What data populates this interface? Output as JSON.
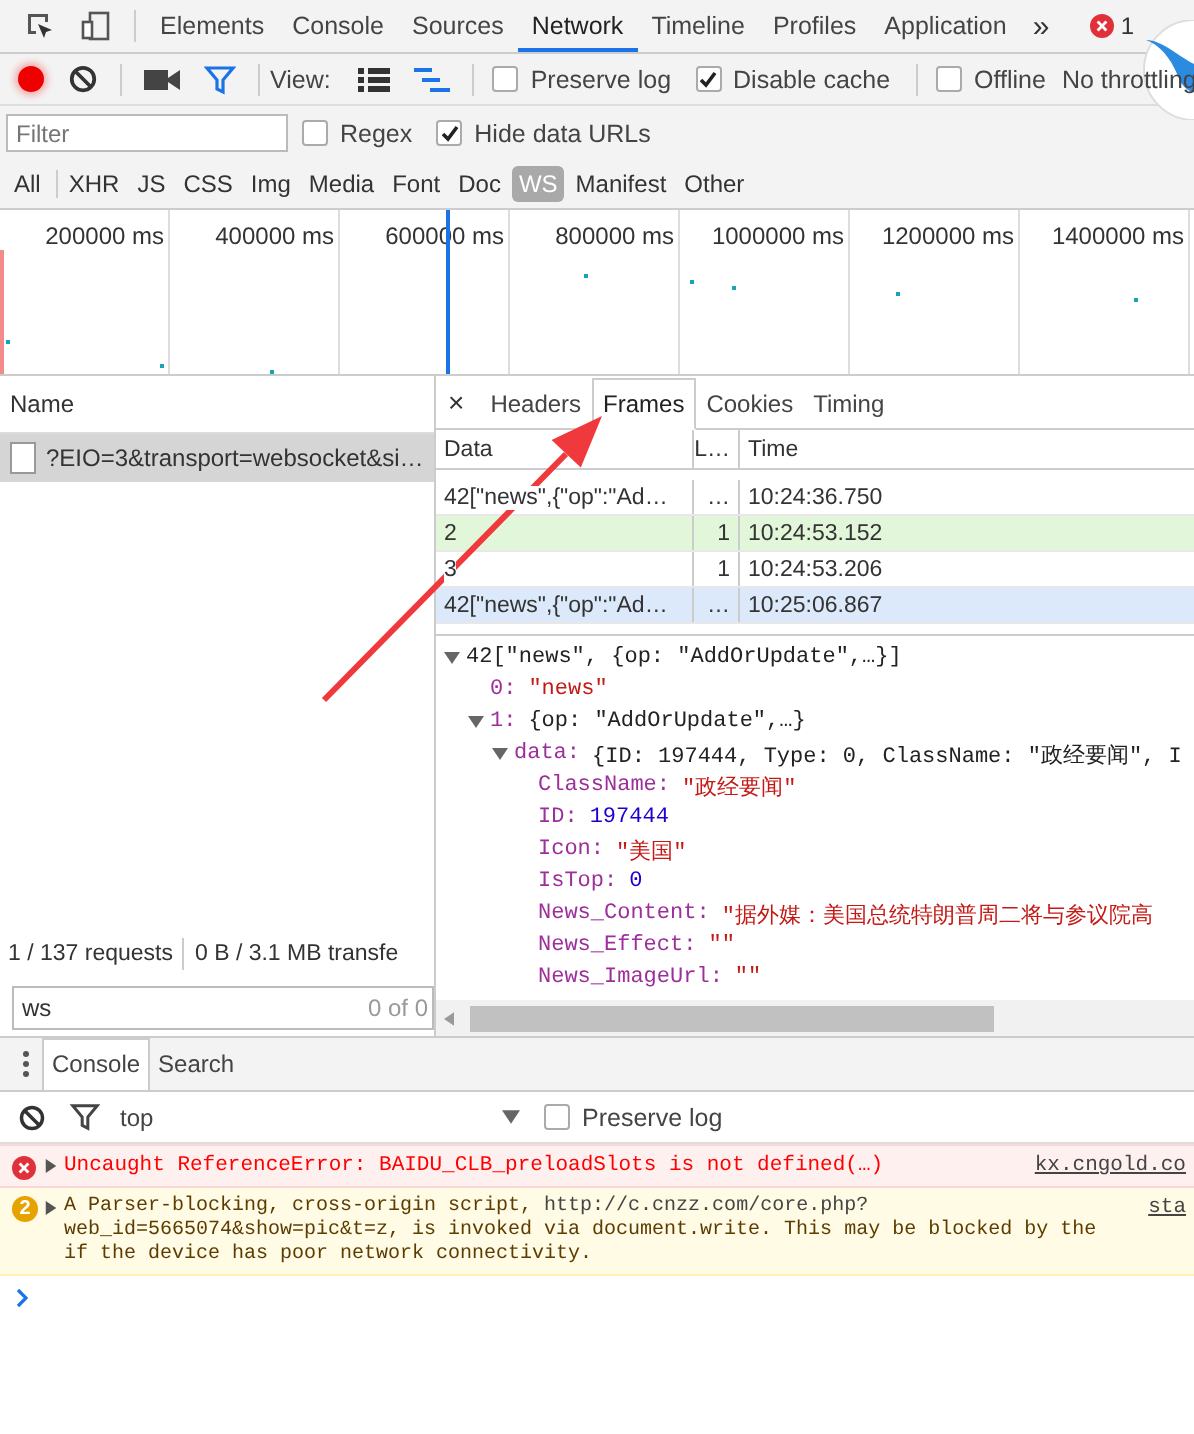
{
  "tabs": [
    {
      "label": "Elements",
      "selected": false
    },
    {
      "label": "Console",
      "selected": false
    },
    {
      "label": "Sources",
      "selected": false
    },
    {
      "label": "Network",
      "selected": true
    },
    {
      "label": "Timeline",
      "selected": false
    },
    {
      "label": "Profiles",
      "selected": false
    },
    {
      "label": "Application",
      "selected": false
    }
  ],
  "overflow": "»",
  "error_count": "1",
  "toolbar": {
    "recording": true,
    "filter_active": true,
    "view_label": "View:",
    "large_rows": false,
    "waterfall": true,
    "checkboxes": [
      {
        "label": "Preserve log",
        "checked": false
      },
      {
        "label": "Disable cache",
        "checked": true
      },
      {
        "label": "Offline",
        "checked": false
      }
    ],
    "throttling": "No throttling"
  },
  "filter": {
    "placeholder": "Filter",
    "checkboxes": [
      {
        "label": "Regex",
        "checked": false
      },
      {
        "label": "Hide data URLs",
        "checked": true
      }
    ]
  },
  "types": [
    {
      "label": "All",
      "selected": false
    },
    {
      "label": "XHR",
      "selected": false
    },
    {
      "label": "JS",
      "selected": false
    },
    {
      "label": "CSS",
      "selected": false
    },
    {
      "label": "Img",
      "selected": false
    },
    {
      "label": "Media",
      "selected": false
    },
    {
      "label": "Font",
      "selected": false
    },
    {
      "label": "Doc",
      "selected": false
    },
    {
      "label": "WS",
      "selected": true
    },
    {
      "label": "Manifest",
      "selected": false
    },
    {
      "label": "Other",
      "selected": false
    }
  ],
  "timeline": {
    "ticks": [
      "200000 ms",
      "400000 ms",
      "600000 ms",
      "800000 ms",
      "1000000 ms",
      "1200000 ms",
      "1400000 ms"
    ]
  },
  "requests": {
    "column": "Name",
    "rows": [
      {
        "name": "?EIO=3&transport=websocket&si…",
        "selected": true
      }
    ],
    "summary": [
      "1 / 137 requests",
      "0 B / 3.1 MB transfe"
    ],
    "search": {
      "value": "ws",
      "count": "0 of 0"
    }
  },
  "detail": {
    "close": "×",
    "tabs": [
      {
        "label": "Headers",
        "selected": false
      },
      {
        "label": "Frames",
        "selected": true
      },
      {
        "label": "Cookies",
        "selected": false
      },
      {
        "label": "Timing",
        "selected": false
      }
    ],
    "frames": {
      "columns": [
        "Data",
        "L…",
        "Time"
      ],
      "rows": [
        {
          "data": "42[\"news\",{\"op\":\"Ad…",
          "length": "…",
          "time": "10:24:36.750",
          "kind": "received",
          "selected": false
        },
        {
          "data": "2",
          "length": "1",
          "time": "10:24:53.152",
          "kind": "sent",
          "selected": false
        },
        {
          "data": "3",
          "length": "1",
          "time": "10:24:53.206",
          "kind": "received",
          "selected": false
        },
        {
          "data": "42[\"news\",{\"op\":\"Ad…",
          "length": "…",
          "time": "10:25:06.867",
          "kind": "received",
          "selected": true
        }
      ]
    },
    "tree": [
      {
        "value": "42[\"news\", {op: \"AddOrUpdate\",…}]",
        "kind": "preview",
        "expanded": true,
        "children": [
          {
            "key": "0:",
            "value": "\"news\"",
            "kind": "string"
          },
          {
            "key": "1:",
            "value": "{op: \"AddOrUpdate\",…}",
            "kind": "preview",
            "expanded": true,
            "children": [
              {
                "key": "data:",
                "value": "{ID: 197444, Type: 0, ClassName: \"政经要闻\", I",
                "kind": "preview",
                "expanded": true,
                "children": [
                  {
                    "key": "ClassName:",
                    "value": "\"政经要闻\"",
                    "kind": "string"
                  },
                  {
                    "key": "ID:",
                    "value": "197444",
                    "kind": "number"
                  },
                  {
                    "key": "Icon:",
                    "value": "\"美国\"",
                    "kind": "string"
                  },
                  {
                    "key": "IsTop:",
                    "value": "0",
                    "kind": "number"
                  },
                  {
                    "key": "News_Content:",
                    "value": "\"据外媒：美国总统特朗普周二将与参议院高",
                    "kind": "string"
                  },
                  {
                    "key": "News_Effect:",
                    "value": "\"\"",
                    "kind": "string"
                  },
                  {
                    "key": "News_ImageUrl:",
                    "value": "\"\"",
                    "kind": "string"
                  }
                ]
              }
            ]
          }
        ]
      }
    ]
  },
  "drawer": {
    "tabs": [
      {
        "label": "Console",
        "selected": true
      },
      {
        "label": "Search",
        "selected": false
      }
    ],
    "context": "top",
    "preserve_log": {
      "label": "Preserve log",
      "checked": false
    },
    "messages": [
      {
        "kind": "error",
        "text": "Uncaught ReferenceError: BAIDU_CLB_preloadSlots is not defined(…)",
        "source": "kx.cngold.co"
      },
      {
        "kind": "warning",
        "count": "2",
        "lines": [
          {
            "text": "A Parser-blocking, cross-origin script, ",
            "link": "http://c.cnzz.com/core.php?"
          },
          {
            "text": "web_id=5665074&show=pic&t=z, is invoked via document.write. This may be blocked by the"
          },
          {
            "text": "if the device has poor network connectivity."
          }
        ],
        "source": "sta"
      }
    ]
  }
}
